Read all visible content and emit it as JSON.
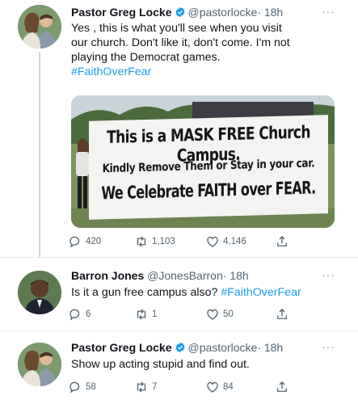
{
  "tweets": [
    {
      "name": "Pastor Greg Locke",
      "handle": "@pastorlocke",
      "time": "· 18h",
      "more": "···",
      "lines": [
        "Yes , this is what you'll see when you visit",
        "our church. Don't like it, don't come. I'm not",
        "playing the Democrat games."
      ],
      "hashtag": "#FaithOverFear",
      "media": {
        "line1": "This is a MASK FREE Church Campus.",
        "line2": "Kindly Remove Them or Stay in your car.",
        "line3": "We Celebrate FAITH over FEAR."
      },
      "replies": "420",
      "retweets": "1,103",
      "likes": "4,146"
    },
    {
      "name": "Barron Jones",
      "handle": "@JonesBarron",
      "time": "· 18h",
      "more": "···",
      "text": "Is it a gun free campus also?",
      "hashtag": "#FaithOverFear",
      "replies": "6",
      "retweets": "1",
      "likes": "50"
    },
    {
      "name": "Pastor Greg Locke",
      "handle": "@pastorlocke",
      "time": "· 18h",
      "more": "···",
      "text": "Show up acting stupid and find out.",
      "replies": "58",
      "retweets": "7",
      "likes": "84"
    }
  ],
  "colors": {
    "accent": "#1d9bf0",
    "text": "#0f1419",
    "secondary": "#536471"
  },
  "icons": [
    "verified-badge-icon",
    "more-icon",
    "reply-icon",
    "retweet-icon",
    "like-icon",
    "share-icon"
  ]
}
